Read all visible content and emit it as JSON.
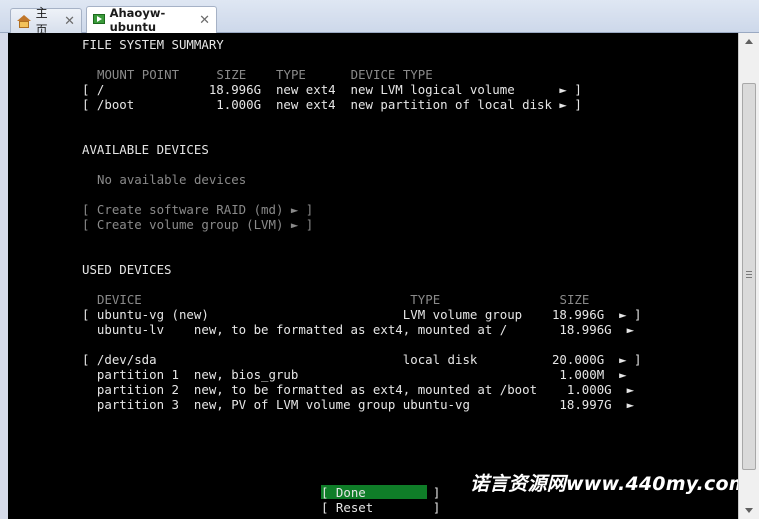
{
  "tabs": [
    {
      "label": "主页",
      "close": "✕",
      "icon": "home-icon"
    },
    {
      "label": "Ahaoyw-ubuntu",
      "close": "✕",
      "icon": "vm-icon"
    }
  ],
  "fs_summary": {
    "title": "FILE SYSTEM SUMMARY",
    "header": "MOUNT POINT     SIZE    TYPE      DEVICE TYPE",
    "rows": [
      "[ /              18.996G  new ext4  new LVM logical volume      ► ]",
      "[ /boot           1.000G  new ext4  new partition of local disk ► ]"
    ]
  },
  "available": {
    "title": "AVAILABLE DEVICES",
    "empty": "No available devices",
    "actions": [
      "[ Create software RAID (md) ► ]",
      "[ Create volume group (LVM) ► ]"
    ]
  },
  "used": {
    "title": "USED DEVICES",
    "header": "DEVICE                                    TYPE                SIZE",
    "rows": [
      "[ ubuntu-vg (new)                          LVM volume group    18.996G  ► ]",
      "  ubuntu-lv    new, to be formatted as ext4, mounted at /       18.996G  ►",
      "[ /dev/sda                                 local disk          20.000G  ► ]",
      "  partition 1  new, bios_grub                                   1.000M  ►",
      "  partition 2  new, to be formatted as ext4, mounted at /boot    1.000G  ►",
      "  partition 3  new, PV of LVM volume group ubuntu-vg            18.997G  ►"
    ]
  },
  "buttons": {
    "done": "[ Done         ]",
    "reset": "[ Reset        ]"
  },
  "watermark": "诺言资源网www.440my.com",
  "colors": {
    "terminal_bg": "#000000",
    "done_highlight": "#0f7d28"
  }
}
